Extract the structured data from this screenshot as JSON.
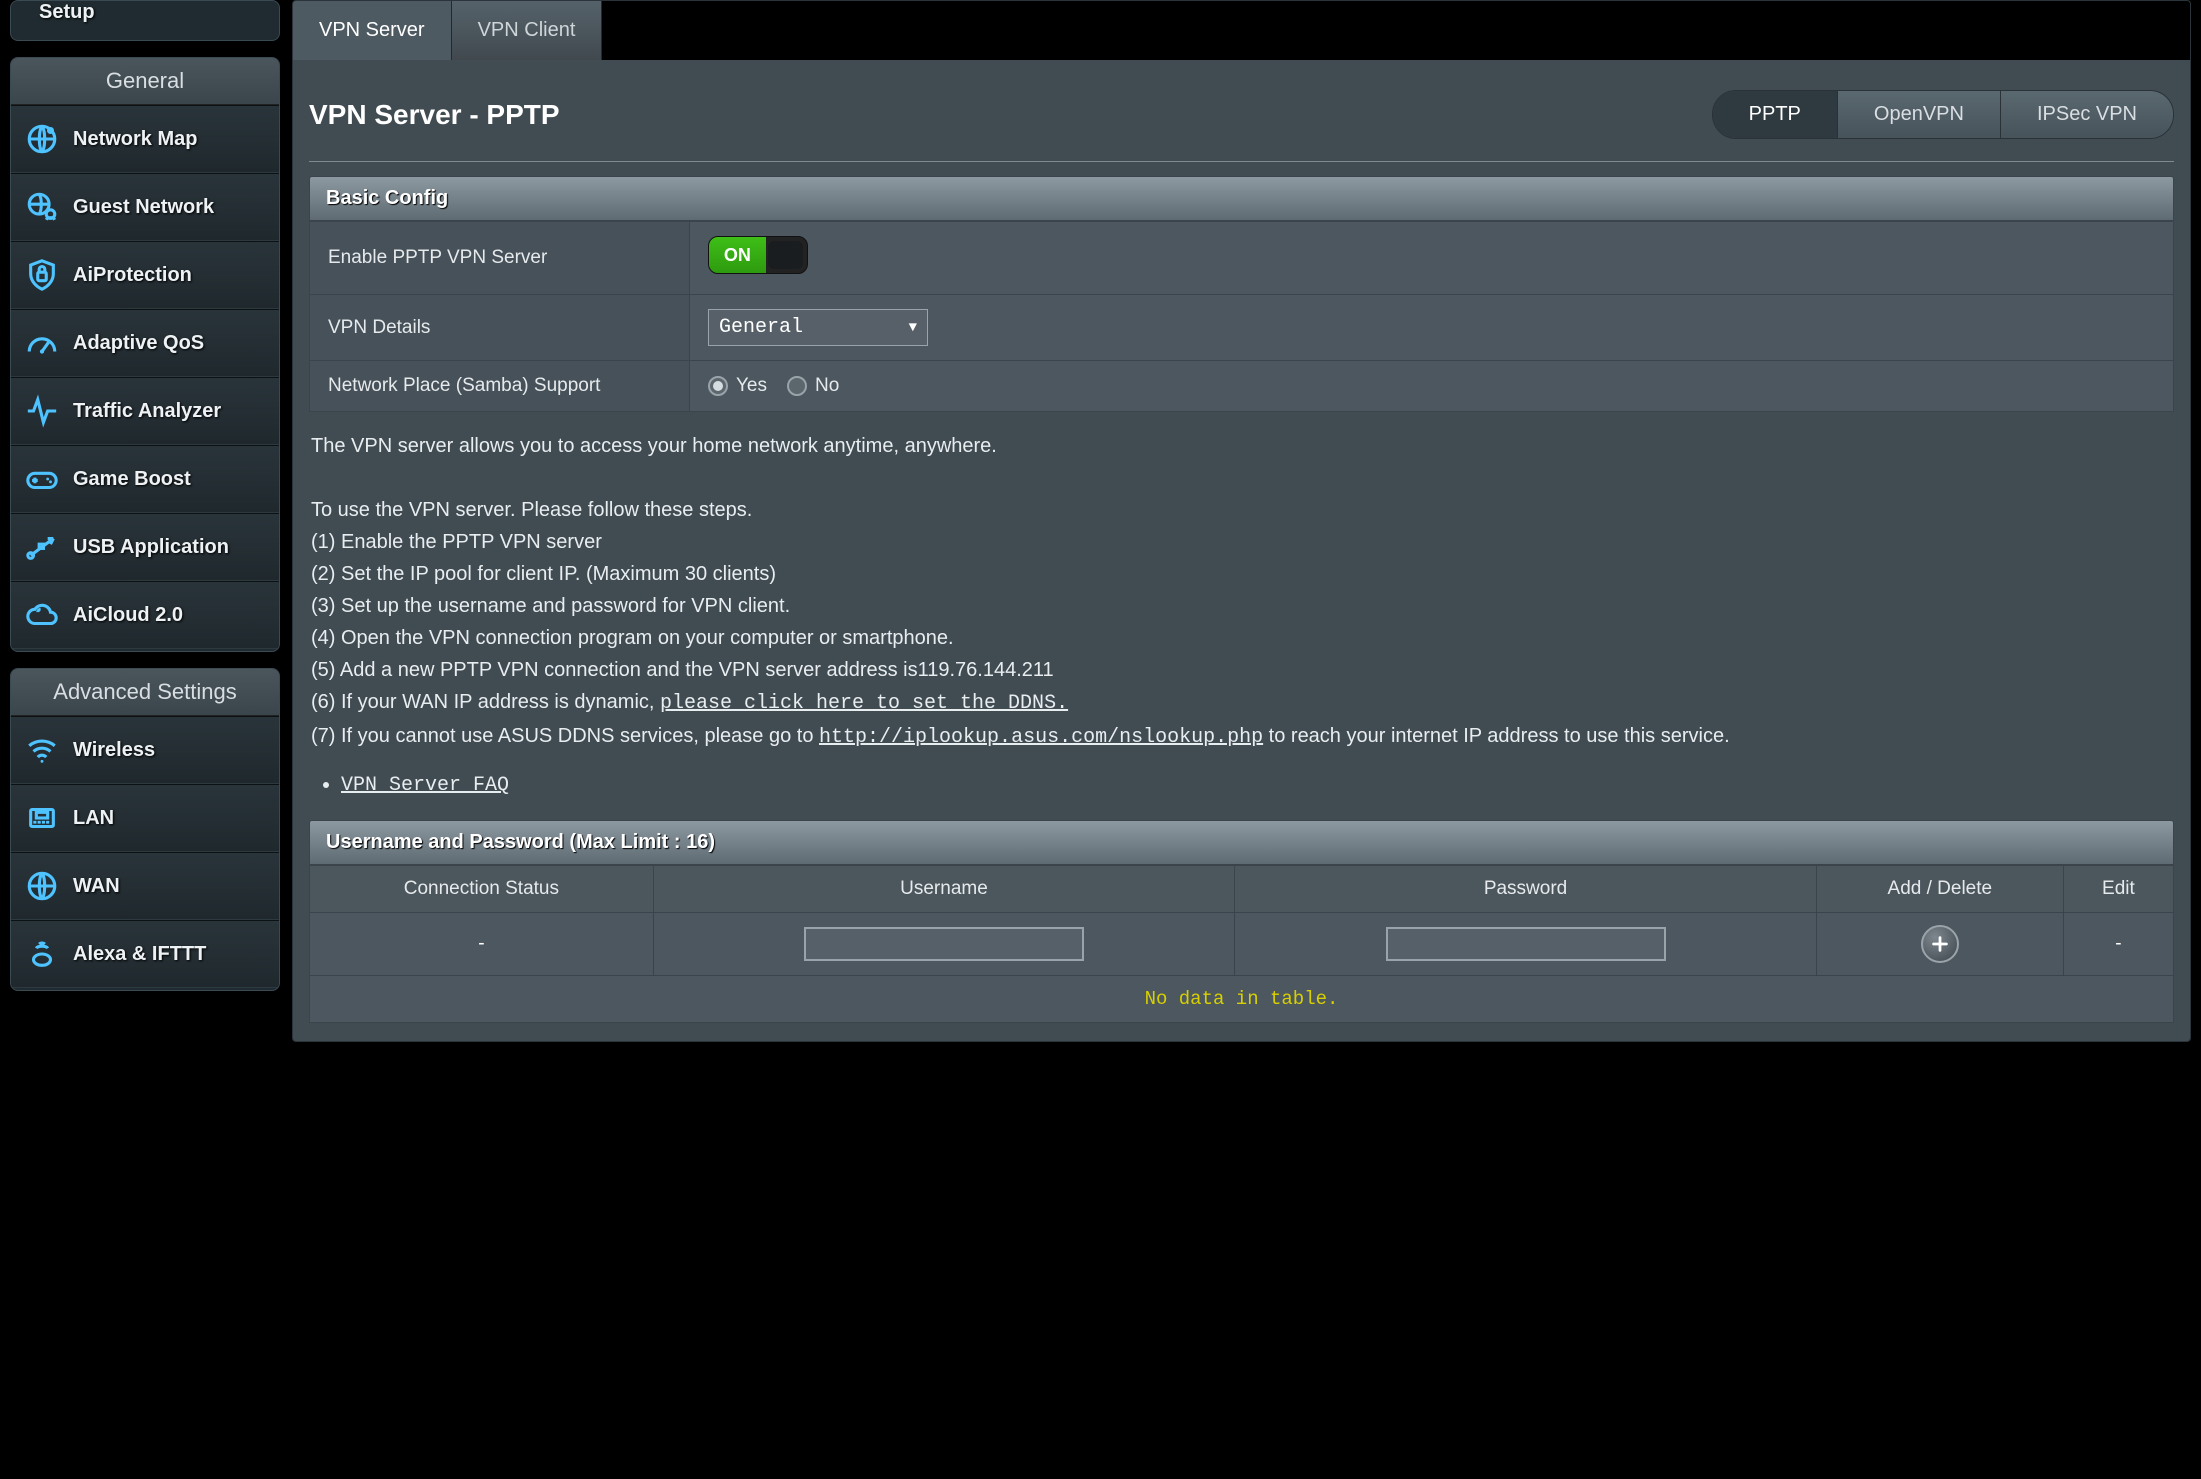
{
  "sidebar": {
    "partial_top": "Setup",
    "group_general_hdr": "General",
    "group_advanced_hdr": "Advanced Settings",
    "general": [
      {
        "label": "Network Map"
      },
      {
        "label": "Guest Network"
      },
      {
        "label": "AiProtection"
      },
      {
        "label": "Adaptive QoS"
      },
      {
        "label": "Traffic Analyzer"
      },
      {
        "label": "Game Boost"
      },
      {
        "label": "USB Application"
      },
      {
        "label": "AiCloud 2.0"
      }
    ],
    "advanced": [
      {
        "label": "Wireless"
      },
      {
        "label": "LAN"
      },
      {
        "label": "WAN"
      },
      {
        "label": "Alexa & IFTTT"
      }
    ]
  },
  "tabs": {
    "server": "VPN Server",
    "client": "VPN Client"
  },
  "title": "VPN Server - PPTP",
  "subtabs": {
    "pptp": "PPTP",
    "openvpn": "OpenVPN",
    "ipsec": "IPSec VPN"
  },
  "basic": {
    "hdr": "Basic Config",
    "enable_lbl": "Enable PPTP VPN Server",
    "enable_on_text": "ON",
    "details_lbl": "VPN Details",
    "details_value": "General",
    "samba_lbl": "Network Place (Samba) Support",
    "samba_yes": "Yes",
    "samba_no": "No"
  },
  "desc": {
    "p1": "The VPN server allows you to access your home network anytime, anywhere.",
    "p2": "To use the VPN server. Please follow these steps.",
    "s1": "(1) Enable the PPTP VPN server",
    "s2": "(2) Set the IP pool for client IP. (Maximum 30 clients)",
    "s3": "(3) Set up the username and password for VPN client.",
    "s4": "(4) Open the VPN connection program on your computer or smartphone.",
    "s5": "(5) Add a new PPTP VPN connection and the VPN server address is119.76.144.211",
    "s6a": "(6) If your WAN IP address is dynamic, ",
    "s6link": "please click here to set the DDNS.",
    "s7a": "(7) If you cannot use ASUS DDNS services, please go to ",
    "s7link": "http://iplookup.asus.com/nslookup.php",
    "s7b": " to reach your internet IP address to use this service.",
    "faq": "VPN Server FAQ"
  },
  "usrpwd": {
    "hdr": "Username and Password (Max Limit : 16)",
    "col_status": "Connection Status",
    "col_user": "Username",
    "col_pass": "Password",
    "col_add": "Add / Delete",
    "col_edit": "Edit",
    "dash": "-",
    "nodata": "No data in table."
  }
}
